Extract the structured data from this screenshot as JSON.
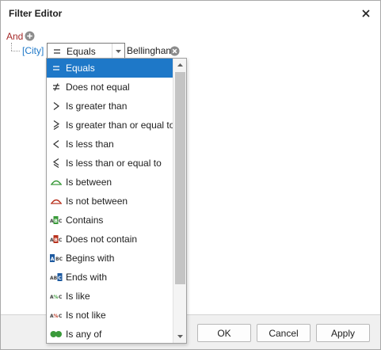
{
  "window": {
    "title": "Filter Editor",
    "close_icon": "close-icon"
  },
  "tree": {
    "group_operator": "And",
    "condition": {
      "field": "[City]",
      "operator": "Equals",
      "value": "Bellingham"
    }
  },
  "dropdown": {
    "selected_index": 0,
    "items": [
      {
        "label": "Equals",
        "icon": "equals-icon"
      },
      {
        "label": "Does not equal",
        "icon": "not-equal-icon"
      },
      {
        "label": "Is greater than",
        "icon": "greater-than-icon"
      },
      {
        "label": "Is greater than or equal to",
        "icon": "greater-equal-icon"
      },
      {
        "label": "Is less than",
        "icon": "less-than-icon"
      },
      {
        "label": "Is less than or equal to",
        "icon": "less-equal-icon"
      },
      {
        "label": "Is between",
        "icon": "between-icon"
      },
      {
        "label": "Is not between",
        "icon": "not-between-icon"
      },
      {
        "label": "Contains",
        "icon": "contains-icon"
      },
      {
        "label": "Does not contain",
        "icon": "not-contain-icon"
      },
      {
        "label": "Begins with",
        "icon": "begins-with-icon"
      },
      {
        "label": "Ends with",
        "icon": "ends-with-icon"
      },
      {
        "label": "Is like",
        "icon": "like-icon"
      },
      {
        "label": "Is not like",
        "icon": "not-like-icon"
      },
      {
        "label": "Is any of",
        "icon": "any-of-icon"
      }
    ]
  },
  "footer": {
    "ok_label": "OK",
    "cancel_label": "Cancel",
    "apply_label": "Apply"
  },
  "colors": {
    "accent": "#1e78c8",
    "group_operator": "#a52a2a",
    "green_icon": "#3a9a3a",
    "red_icon": "#b8321e"
  }
}
